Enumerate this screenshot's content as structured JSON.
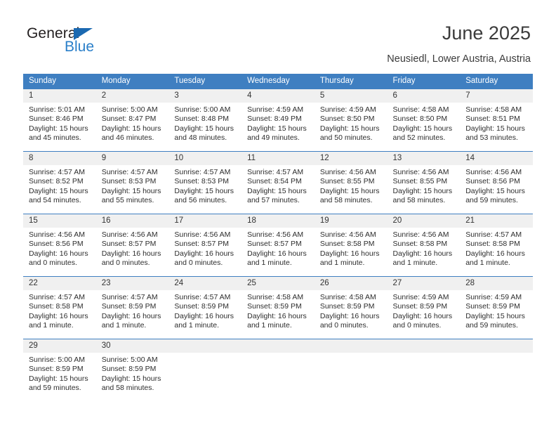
{
  "brand": {
    "word_one": "General",
    "word_two": "Blue",
    "triangle_icon": "triangle-icon",
    "accent_color": "#2a7fc9"
  },
  "header": {
    "title": "June 2025",
    "location": "Neusiedl, Lower Austria, Austria"
  },
  "calendar": {
    "header_background": "#3f7fc1",
    "daynum_background": "#f0f0f0",
    "weekdays": [
      "Sunday",
      "Monday",
      "Tuesday",
      "Wednesday",
      "Thursday",
      "Friday",
      "Saturday"
    ],
    "weeks": [
      [
        {
          "day": "1",
          "lines": "Sunrise: 5:01 AM\nSunset: 8:46 PM\nDaylight: 15 hours\nand 45 minutes."
        },
        {
          "day": "2",
          "lines": "Sunrise: 5:00 AM\nSunset: 8:47 PM\nDaylight: 15 hours\nand 46 minutes."
        },
        {
          "day": "3",
          "lines": "Sunrise: 5:00 AM\nSunset: 8:48 PM\nDaylight: 15 hours\nand 48 minutes."
        },
        {
          "day": "4",
          "lines": "Sunrise: 4:59 AM\nSunset: 8:49 PM\nDaylight: 15 hours\nand 49 minutes."
        },
        {
          "day": "5",
          "lines": "Sunrise: 4:59 AM\nSunset: 8:50 PM\nDaylight: 15 hours\nand 50 minutes."
        },
        {
          "day": "6",
          "lines": "Sunrise: 4:58 AM\nSunset: 8:50 PM\nDaylight: 15 hours\nand 52 minutes."
        },
        {
          "day": "7",
          "lines": "Sunrise: 4:58 AM\nSunset: 8:51 PM\nDaylight: 15 hours\nand 53 minutes."
        }
      ],
      [
        {
          "day": "8",
          "lines": "Sunrise: 4:57 AM\nSunset: 8:52 PM\nDaylight: 15 hours\nand 54 minutes."
        },
        {
          "day": "9",
          "lines": "Sunrise: 4:57 AM\nSunset: 8:53 PM\nDaylight: 15 hours\nand 55 minutes."
        },
        {
          "day": "10",
          "lines": "Sunrise: 4:57 AM\nSunset: 8:53 PM\nDaylight: 15 hours\nand 56 minutes."
        },
        {
          "day": "11",
          "lines": "Sunrise: 4:57 AM\nSunset: 8:54 PM\nDaylight: 15 hours\nand 57 minutes."
        },
        {
          "day": "12",
          "lines": "Sunrise: 4:56 AM\nSunset: 8:55 PM\nDaylight: 15 hours\nand 58 minutes."
        },
        {
          "day": "13",
          "lines": "Sunrise: 4:56 AM\nSunset: 8:55 PM\nDaylight: 15 hours\nand 58 minutes."
        },
        {
          "day": "14",
          "lines": "Sunrise: 4:56 AM\nSunset: 8:56 PM\nDaylight: 15 hours\nand 59 minutes."
        }
      ],
      [
        {
          "day": "15",
          "lines": "Sunrise: 4:56 AM\nSunset: 8:56 PM\nDaylight: 16 hours\nand 0 minutes."
        },
        {
          "day": "16",
          "lines": "Sunrise: 4:56 AM\nSunset: 8:57 PM\nDaylight: 16 hours\nand 0 minutes."
        },
        {
          "day": "17",
          "lines": "Sunrise: 4:56 AM\nSunset: 8:57 PM\nDaylight: 16 hours\nand 0 minutes."
        },
        {
          "day": "18",
          "lines": "Sunrise: 4:56 AM\nSunset: 8:57 PM\nDaylight: 16 hours\nand 1 minute."
        },
        {
          "day": "19",
          "lines": "Sunrise: 4:56 AM\nSunset: 8:58 PM\nDaylight: 16 hours\nand 1 minute."
        },
        {
          "day": "20",
          "lines": "Sunrise: 4:56 AM\nSunset: 8:58 PM\nDaylight: 16 hours\nand 1 minute."
        },
        {
          "day": "21",
          "lines": "Sunrise: 4:57 AM\nSunset: 8:58 PM\nDaylight: 16 hours\nand 1 minute."
        }
      ],
      [
        {
          "day": "22",
          "lines": "Sunrise: 4:57 AM\nSunset: 8:58 PM\nDaylight: 16 hours\nand 1 minute."
        },
        {
          "day": "23",
          "lines": "Sunrise: 4:57 AM\nSunset: 8:59 PM\nDaylight: 16 hours\nand 1 minute."
        },
        {
          "day": "24",
          "lines": "Sunrise: 4:57 AM\nSunset: 8:59 PM\nDaylight: 16 hours\nand 1 minute."
        },
        {
          "day": "25",
          "lines": "Sunrise: 4:58 AM\nSunset: 8:59 PM\nDaylight: 16 hours\nand 1 minute."
        },
        {
          "day": "26",
          "lines": "Sunrise: 4:58 AM\nSunset: 8:59 PM\nDaylight: 16 hours\nand 0 minutes."
        },
        {
          "day": "27",
          "lines": "Sunrise: 4:59 AM\nSunset: 8:59 PM\nDaylight: 16 hours\nand 0 minutes."
        },
        {
          "day": "28",
          "lines": "Sunrise: 4:59 AM\nSunset: 8:59 PM\nDaylight: 15 hours\nand 59 minutes."
        }
      ],
      [
        {
          "day": "29",
          "lines": "Sunrise: 5:00 AM\nSunset: 8:59 PM\nDaylight: 15 hours\nand 59 minutes."
        },
        {
          "day": "30",
          "lines": "Sunrise: 5:00 AM\nSunset: 8:59 PM\nDaylight: 15 hours\nand 58 minutes."
        },
        {
          "day": "",
          "lines": ""
        },
        {
          "day": "",
          "lines": ""
        },
        {
          "day": "",
          "lines": ""
        },
        {
          "day": "",
          "lines": ""
        },
        {
          "day": "",
          "lines": ""
        }
      ]
    ]
  }
}
